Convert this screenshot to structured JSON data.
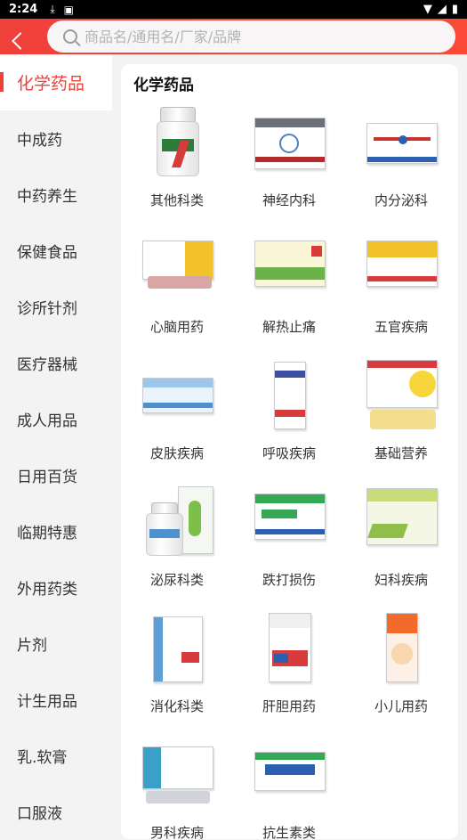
{
  "status_bar": {
    "time": "2:24"
  },
  "search": {
    "placeholder": "商品名/通用名/厂家/品牌"
  },
  "sidebar": {
    "items": [
      {
        "label": "化学药品",
        "active": true
      },
      {
        "label": "中成药"
      },
      {
        "label": "中药养生"
      },
      {
        "label": "保健食品"
      },
      {
        "label": "诊所针剂"
      },
      {
        "label": "医疗器械"
      },
      {
        "label": "成人用品"
      },
      {
        "label": "日用百货"
      },
      {
        "label": "临期特惠"
      },
      {
        "label": "外用药类"
      },
      {
        "label": "片剂"
      },
      {
        "label": "计生用品"
      },
      {
        "label": "乳.软膏"
      },
      {
        "label": "口服液"
      }
    ]
  },
  "content": {
    "title": "化学药品",
    "categories": [
      {
        "label": "其他科类",
        "icon": "medicine-bottle-icon"
      },
      {
        "label": "神经内科",
        "icon": "medicine-box-icon"
      },
      {
        "label": "内分泌科",
        "icon": "medicine-box-icon"
      },
      {
        "label": "心脑用药",
        "icon": "medicine-box-icon"
      },
      {
        "label": "解热止痛",
        "icon": "medicine-box-icon"
      },
      {
        "label": "五官疾病",
        "icon": "medicine-box-icon"
      },
      {
        "label": "皮肤疾病",
        "icon": "ointment-box-icon"
      },
      {
        "label": "呼吸疾病",
        "icon": "medicine-box-icon"
      },
      {
        "label": "基础营养",
        "icon": "vitamin-box-icon"
      },
      {
        "label": "泌尿科类",
        "icon": "medicine-bottle-icon"
      },
      {
        "label": "跌打损伤",
        "icon": "capsule-box-icon"
      },
      {
        "label": "妇科疾病",
        "icon": "capsule-box-icon"
      },
      {
        "label": "消化科类",
        "icon": "capsule-box-icon"
      },
      {
        "label": "肝胆用药",
        "icon": "capsule-box-icon"
      },
      {
        "label": "小儿用药",
        "icon": "syrup-box-icon"
      },
      {
        "label": "男科疾病",
        "icon": "medicine-box-icon"
      },
      {
        "label": "抗生素类",
        "icon": "capsule-box-icon"
      }
    ]
  },
  "colors": {
    "accent": "#f0403a",
    "header_bg": "#f0403a"
  }
}
